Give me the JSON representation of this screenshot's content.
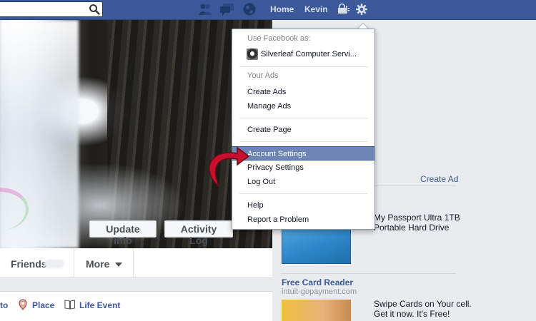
{
  "topbar": {
    "search_value": "",
    "home_label": "Home",
    "user_label": "Kevin"
  },
  "cover": {
    "update_info_label": "Update Info",
    "activity_log_label": "Activity Log"
  },
  "tabs": {
    "friends_label": "Friends",
    "more_label": "More"
  },
  "composer": {
    "photo_label": "to",
    "place_label": "Place",
    "life_event_label": "Life Event"
  },
  "ads": {
    "create_ad_label": "Create Ad",
    "ad1_line1": "My Passport Ultra 1TB",
    "ad1_line2": "Portable Hard Drive",
    "ad2_title": "Free Card Reader",
    "ad2_url": "intuit-gopayment.com",
    "ad2_line1": "Swipe Cards on Your cell.",
    "ad2_line2": "Get it now. It's Free!"
  },
  "menu": {
    "use_as_header": "Use Facebook as:",
    "page_name": "Silverleaf Computer Servi...",
    "your_ads_header": "Your Ads",
    "create_ads": "Create Ads",
    "manage_ads": "Manage Ads",
    "create_page": "Create Page",
    "account_settings": "Account Settings",
    "privacy_settings": "Privacy Settings",
    "log_out": "Log Out",
    "help": "Help",
    "report_problem": "Report a Problem"
  },
  "colors": {
    "topbar": "#3b5998",
    "menu_highlight": "#6d84b4",
    "link": "#3b5998",
    "arrow": "#c8102e"
  }
}
